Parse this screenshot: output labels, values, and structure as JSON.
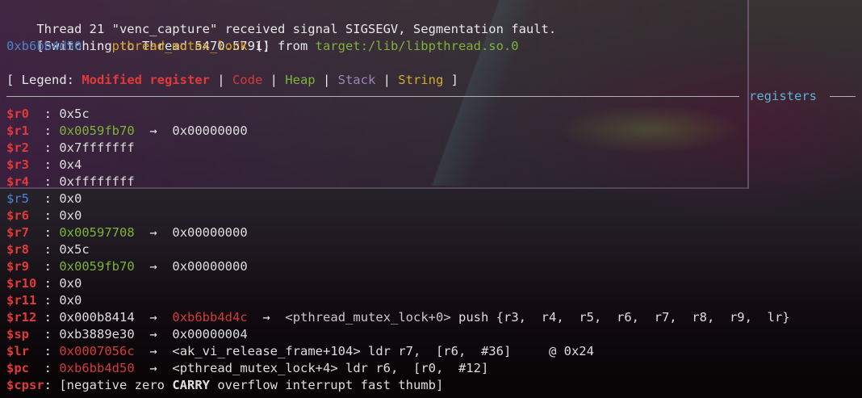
{
  "header": {
    "signal_line": "Thread 21 \"venc_capture\" received signal SIGSEGV, Segmentation fault.",
    "switch_line": "[Switching to Thread 5470.5791]",
    "fault": {
      "address": "0xb6bb4d50",
      "in": " in ",
      "function": "pthread_mutex_lock",
      "suffix": " () from ",
      "library": "target:/lib/libpthread.so.0"
    }
  },
  "legend": {
    "open": "[ Legend: ",
    "modified": "Modified register",
    "sep": " | ",
    "code": "Code",
    "heap": "Heap",
    "stack": "Stack",
    "string": "String",
    "close": " ]"
  },
  "section_title": "registers",
  "colors": {
    "modified_register": "#e03a3a",
    "unmodified_register": "#4d83d8",
    "code": "#d43a3a",
    "heap": "#7eb23a",
    "stack": "#9c85b7",
    "string": "#d4aa2c",
    "separator_label": "#5ab4d4"
  },
  "arrow": "→",
  "colon": ": ",
  "registers": [
    {
      "name": "$r0",
      "pad": "  ",
      "value": "0x5c"
    },
    {
      "name": "$r1",
      "pad": "  ",
      "value": "0x0059fb70",
      "deref": "0x00000000"
    },
    {
      "name": "$r2",
      "pad": "  ",
      "value": "0x7fffffff"
    },
    {
      "name": "$r3",
      "pad": "  ",
      "value": "0x4"
    },
    {
      "name": "$r4",
      "pad": "  ",
      "value": "0xffffffff"
    },
    {
      "name": "$r5",
      "pad": "  ",
      "value": "0x0"
    },
    {
      "name": "$r6",
      "pad": "  ",
      "value": "0x0"
    },
    {
      "name": "$r7",
      "pad": "  ",
      "value": "0x00597708",
      "deref": "0x00000000"
    },
    {
      "name": "$r8",
      "pad": "  ",
      "value": "0x5c"
    },
    {
      "name": "$r9",
      "pad": "  ",
      "value": "0x0059fb70",
      "deref": "0x00000000"
    },
    {
      "name": "$r10",
      "pad": " ",
      "value": "0x0"
    },
    {
      "name": "$r11",
      "pad": " ",
      "value": "0x0"
    },
    {
      "name": "$r12",
      "pad": " ",
      "value": "0x000b8414",
      "deref": "0xb6bb4d4c",
      "symbol": "<pthread_mutex_lock+0>",
      "insn": " push {r3,  r4,  r5,  r6,  r7,  r8,  r9,  lr}"
    },
    {
      "name": "$sp",
      "pad": "  ",
      "value": "0xb3889e30",
      "deref": "0x00000004"
    },
    {
      "name": "$lr",
      "pad": "  ",
      "value": "0x0007056c",
      "symbol": "<ak_vi_release_frame+104>",
      "insn": " ldr r7,  [r6,  #36]     @ 0x24"
    },
    {
      "name": "$pc",
      "pad": "  ",
      "value": "0xb6bb4d50",
      "symbol": "<pthread_mutex_lock+4>",
      "insn": " ldr r6,  [r0,  #12]"
    },
    {
      "name": "$cpsr",
      "pad": "",
      "flags_open": "[negative zero ",
      "flags_set": "CARRY",
      "flags_close": " overflow interrupt fast thumb]"
    }
  ]
}
